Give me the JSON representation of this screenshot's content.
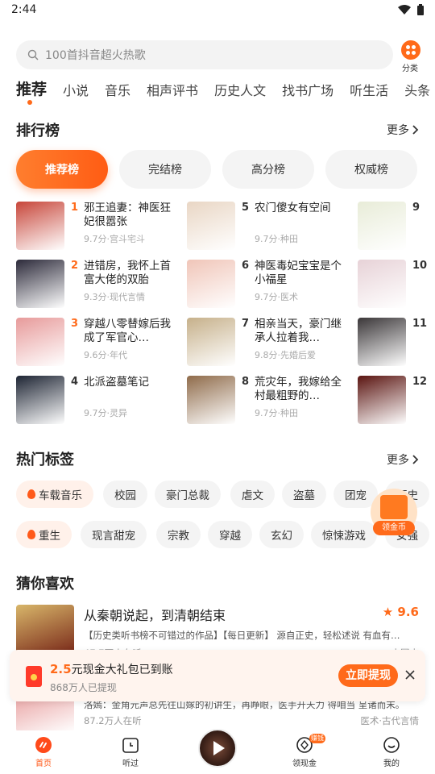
{
  "status_bar": {
    "time": "2:44"
  },
  "search": {
    "placeholder": "100首抖音超火热歌",
    "category_label": "分类"
  },
  "channels": [
    "推荐",
    "小说",
    "音乐",
    "相声评书",
    "历史人文",
    "找书广场",
    "听生活",
    "头条"
  ],
  "ranking": {
    "title": "排行榜",
    "more": "更多",
    "pills": [
      "推荐榜",
      "完结榜",
      "高分榜",
      "权威榜"
    ],
    "items": [
      {
        "rank": "1",
        "title": "邪王追妻：神医狂妃很嚣张",
        "meta": "9.7分·宫斗宅斗",
        "cover_color": "#c7463a"
      },
      {
        "rank": "2",
        "title": "进错房，我怀上首富大佬的双胎",
        "meta": "9.3分·现代言情",
        "cover_color": "#2c2a3a"
      },
      {
        "rank": "3",
        "title": "穿越八零替嫁后我成了军官心…",
        "meta": "9.6分·年代",
        "cover_color": "#e79a9a"
      },
      {
        "rank": "4",
        "title": "北派盗墓笔记",
        "meta": "9.7分·灵异",
        "cover_color": "#1d2433"
      },
      {
        "rank": "5",
        "title": "农门傻女有空间",
        "meta": "9.7分·种田",
        "cover_color": "#e9d6c4"
      },
      {
        "rank": "6",
        "title": "神医毒妃宝宝是个小福星",
        "meta": "9.7分·医术",
        "cover_color": "#f0c5b8"
      },
      {
        "rank": "7",
        "title": "相亲当天，豪门继承人拉着我…",
        "meta": "9.8分·先婚后爱",
        "cover_color": "#c6b08a"
      },
      {
        "rank": "8",
        "title": "荒灾年，我嫁给全村最粗野的…",
        "meta": "9.7分·种田",
        "cover_color": "#8f6b4a"
      },
      {
        "rank": "9",
        "title": "",
        "meta": "",
        "cover_color": "#e8ecd8"
      },
      {
        "rank": "10",
        "title": "",
        "meta": "",
        "cover_color": "#e7d2d7"
      },
      {
        "rank": "11",
        "title": "",
        "meta": "",
        "cover_color": "#3a3638"
      },
      {
        "rank": "12",
        "title": "",
        "meta": "",
        "cover_color": "#5a1410"
      }
    ]
  },
  "tags": {
    "title": "热门标签",
    "more": "更多",
    "row1": [
      "车载音乐",
      "校园",
      "豪门总裁",
      "虐文",
      "盗墓",
      "团宠",
      "历史"
    ],
    "row2": [
      "重生",
      "现言甜宠",
      "宗教",
      "穿越",
      "玄幻",
      "惊悚游戏",
      "女强"
    ],
    "hot_tags": [
      "车载音乐",
      "重生"
    ]
  },
  "floating_coin": {
    "label": "领金币"
  },
  "guess": {
    "title": "猜你喜欢",
    "books": [
      {
        "title": "从秦朝说起，到清朝结束",
        "score": "9.6",
        "desc": "【历史类听书榜不可错过的作品】【每日更新】 源自正史，轻松述说 有血有…",
        "listeners": "47.7万人在听",
        "category": "中国史",
        "cover_color": "#d8b66a"
      },
      {
        "title": "",
        "score": "",
        "desc": "洛嫣：金角元声总先往山嫁的初讲生，再睁眼，医手开天力 得咱当 呈诸而末。",
        "listeners": "87.2万人在听",
        "category": "医术·古代言情",
        "cover_color": "#e9a2a2"
      }
    ]
  },
  "promo": {
    "amount": "2.5",
    "text_rest": "元现金大礼包已到账",
    "sub": "868万人已提现",
    "button": "立即提现"
  },
  "bottom_nav": {
    "items": [
      "首页",
      "听过",
      "领现金",
      "我的"
    ],
    "badge": "赚钱"
  },
  "colors": {
    "accent": "#ff6a1a",
    "background": "#ffffff",
    "pill_bg": "#f4f4f4"
  }
}
